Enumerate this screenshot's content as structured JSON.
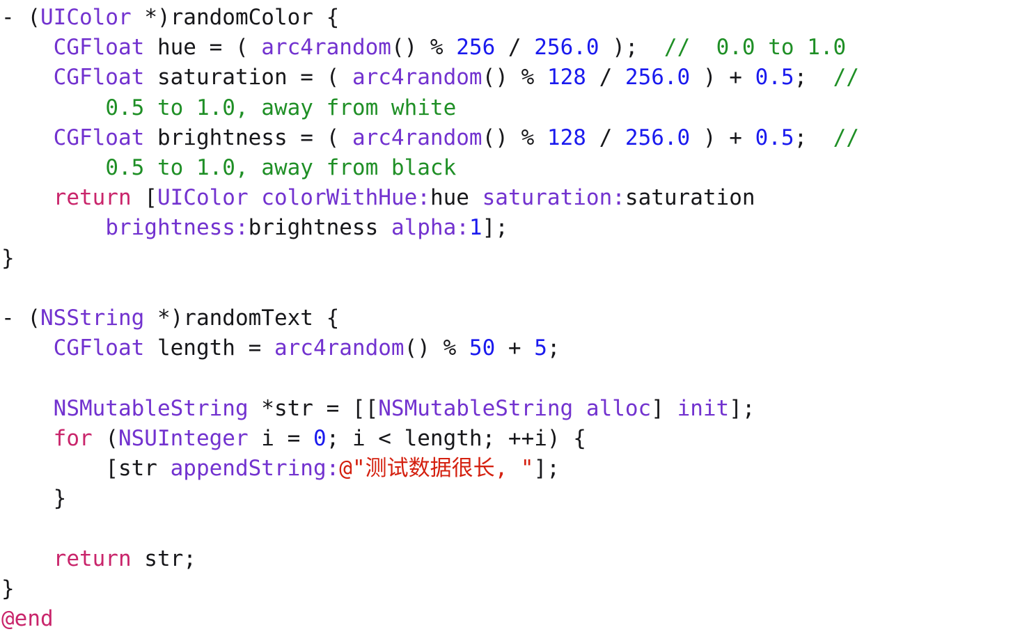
{
  "document": {
    "kind": "source-code-listing",
    "language": "Objective-C",
    "background_color": "#ffffff",
    "palette": {
      "plain": "#17171a",
      "type": "#7232cf",
      "keyword": "#c9256b",
      "number": "#1a1aee",
      "comment": "#1f8f26",
      "string": "#d4200f",
      "method": "#7232cf"
    },
    "plain_text": "- (UIColor *)randomColor {\n    CGFloat hue = ( arc4random() % 256 / 256.0 );  //  0.0 to 1.0\n    CGFloat saturation = ( arc4random() % 128 / 256.0 ) + 0.5;  //\n        0.5 to 1.0, away from white\n    CGFloat brightness = ( arc4random() % 128 / 256.0 ) + 0.5;  //\n        0.5 to 1.0, away from black\n    return [UIColor colorWithHue:hue saturation:saturation\n        brightness:brightness alpha:1];\n}\n\n- (NSString *)randomText {\n    CGFloat length = arc4random() % 50 + 5;\n\n    NSMutableString *str = [[NSMutableString alloc] init];\n    for (NSUInteger i = 0; i < length; ++i) {\n        [str appendString:@\"测试数据很长, \"];\n    }\n\n    return str;\n}\n@end",
    "lines": [
      {
        "index": 1,
        "tokens": [
          {
            "t": "- ",
            "c": "plain"
          },
          {
            "t": "(",
            "c": "plain"
          },
          {
            "t": "UIColor",
            "c": "type"
          },
          {
            "t": " *)randomColor {",
            "c": "plain"
          }
        ]
      },
      {
        "index": 2,
        "tokens": [
          {
            "t": "    ",
            "c": "plain"
          },
          {
            "t": "CGFloat",
            "c": "type"
          },
          {
            "t": " hue = ( ",
            "c": "plain"
          },
          {
            "t": "arc4random",
            "c": "method"
          },
          {
            "t": "() % ",
            "c": "plain"
          },
          {
            "t": "256",
            "c": "number"
          },
          {
            "t": " / ",
            "c": "plain"
          },
          {
            "t": "256.0",
            "c": "number"
          },
          {
            "t": " );  ",
            "c": "plain"
          },
          {
            "t": "//  0.0 to 1.0",
            "c": "comment"
          }
        ]
      },
      {
        "index": 3,
        "tokens": [
          {
            "t": "    ",
            "c": "plain"
          },
          {
            "t": "CGFloat",
            "c": "type"
          },
          {
            "t": " saturation = ( ",
            "c": "plain"
          },
          {
            "t": "arc4random",
            "c": "method"
          },
          {
            "t": "() % ",
            "c": "plain"
          },
          {
            "t": "128",
            "c": "number"
          },
          {
            "t": " / ",
            "c": "plain"
          },
          {
            "t": "256.0",
            "c": "number"
          },
          {
            "t": " ) + ",
            "c": "plain"
          },
          {
            "t": "0.5",
            "c": "number"
          },
          {
            "t": ";  ",
            "c": "plain"
          },
          {
            "t": "//",
            "c": "comment"
          }
        ]
      },
      {
        "index": 4,
        "tokens": [
          {
            "t": "        ",
            "c": "plain"
          },
          {
            "t": "0.5 to 1.0, away from white",
            "c": "comment"
          }
        ]
      },
      {
        "index": 5,
        "tokens": [
          {
            "t": "    ",
            "c": "plain"
          },
          {
            "t": "CGFloat",
            "c": "type"
          },
          {
            "t": " brightness = ( ",
            "c": "plain"
          },
          {
            "t": "arc4random",
            "c": "method"
          },
          {
            "t": "() % ",
            "c": "plain"
          },
          {
            "t": "128",
            "c": "number"
          },
          {
            "t": " / ",
            "c": "plain"
          },
          {
            "t": "256.0",
            "c": "number"
          },
          {
            "t": " ) + ",
            "c": "plain"
          },
          {
            "t": "0.5",
            "c": "number"
          },
          {
            "t": ";  ",
            "c": "plain"
          },
          {
            "t": "//",
            "c": "comment"
          }
        ]
      },
      {
        "index": 6,
        "tokens": [
          {
            "t": "        ",
            "c": "plain"
          },
          {
            "t": "0.5 to 1.0, away from black",
            "c": "comment"
          }
        ]
      },
      {
        "index": 7,
        "tokens": [
          {
            "t": "    ",
            "c": "plain"
          },
          {
            "t": "return",
            "c": "keyword"
          },
          {
            "t": " [",
            "c": "plain"
          },
          {
            "t": "UIColor",
            "c": "type"
          },
          {
            "t": " ",
            "c": "plain"
          },
          {
            "t": "colorWithHue:",
            "c": "method"
          },
          {
            "t": "hue ",
            "c": "plain"
          },
          {
            "t": "saturation:",
            "c": "method"
          },
          {
            "t": "saturation",
            "c": "plain"
          }
        ]
      },
      {
        "index": 8,
        "tokens": [
          {
            "t": "        ",
            "c": "plain"
          },
          {
            "t": "brightness:",
            "c": "method"
          },
          {
            "t": "brightness ",
            "c": "plain"
          },
          {
            "t": "alpha:",
            "c": "method"
          },
          {
            "t": "1",
            "c": "number"
          },
          {
            "t": "];",
            "c": "plain"
          }
        ]
      },
      {
        "index": 9,
        "tokens": [
          {
            "t": "}",
            "c": "plain"
          }
        ]
      },
      {
        "index": 10,
        "tokens": []
      },
      {
        "index": 11,
        "tokens": [
          {
            "t": "- ",
            "c": "plain"
          },
          {
            "t": "(",
            "c": "plain"
          },
          {
            "t": "NSString",
            "c": "type"
          },
          {
            "t": " *)randomText {",
            "c": "plain"
          }
        ]
      },
      {
        "index": 12,
        "tokens": [
          {
            "t": "    ",
            "c": "plain"
          },
          {
            "t": "CGFloat",
            "c": "type"
          },
          {
            "t": " length = ",
            "c": "plain"
          },
          {
            "t": "arc4random",
            "c": "method"
          },
          {
            "t": "() % ",
            "c": "plain"
          },
          {
            "t": "50",
            "c": "number"
          },
          {
            "t": " + ",
            "c": "plain"
          },
          {
            "t": "5",
            "c": "number"
          },
          {
            "t": ";",
            "c": "plain"
          }
        ]
      },
      {
        "index": 13,
        "tokens": []
      },
      {
        "index": 14,
        "tokens": [
          {
            "t": "    ",
            "c": "plain"
          },
          {
            "t": "NSMutableString",
            "c": "type"
          },
          {
            "t": " *str = [[",
            "c": "plain"
          },
          {
            "t": "NSMutableString",
            "c": "type"
          },
          {
            "t": " ",
            "c": "plain"
          },
          {
            "t": "alloc",
            "c": "method"
          },
          {
            "t": "] ",
            "c": "plain"
          },
          {
            "t": "init",
            "c": "method"
          },
          {
            "t": "];",
            "c": "plain"
          }
        ]
      },
      {
        "index": 15,
        "tokens": [
          {
            "t": "    ",
            "c": "plain"
          },
          {
            "t": "for",
            "c": "keyword"
          },
          {
            "t": " (",
            "c": "plain"
          },
          {
            "t": "NSUInteger",
            "c": "type"
          },
          {
            "t": " i = ",
            "c": "plain"
          },
          {
            "t": "0",
            "c": "number"
          },
          {
            "t": "; i < length; ++i) {",
            "c": "plain"
          }
        ]
      },
      {
        "index": 16,
        "tokens": [
          {
            "t": "        ",
            "c": "plain"
          },
          {
            "t": "[str ",
            "c": "plain"
          },
          {
            "t": "appendString:",
            "c": "method"
          },
          {
            "t": "@\"测试数据很长, \"",
            "c": "string"
          },
          {
            "t": "];",
            "c": "plain"
          }
        ]
      },
      {
        "index": 17,
        "tokens": [
          {
            "t": "    }",
            "c": "plain"
          }
        ]
      },
      {
        "index": 18,
        "tokens": []
      },
      {
        "index": 19,
        "tokens": [
          {
            "t": "    ",
            "c": "plain"
          },
          {
            "t": "return",
            "c": "keyword"
          },
          {
            "t": " str;",
            "c": "plain"
          }
        ]
      },
      {
        "index": 20,
        "tokens": [
          {
            "t": "}",
            "c": "plain"
          }
        ]
      },
      {
        "index": 21,
        "tokens": [
          {
            "t": "@end",
            "c": "keyword"
          }
        ]
      }
    ]
  }
}
